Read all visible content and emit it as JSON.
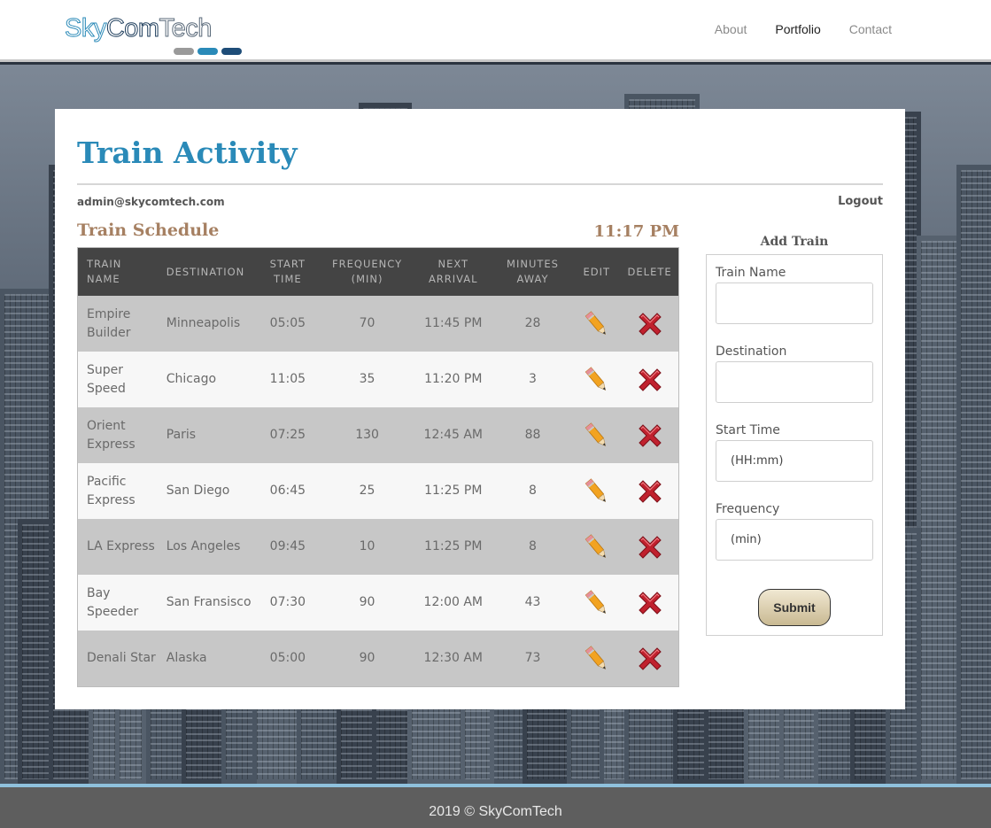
{
  "brand": {
    "name": "SkyComTech",
    "part1": "Sky",
    "part2": "Com",
    "part3": "Tech",
    "pill_colors": [
      "#9a9a9a",
      "#2a8ab8",
      "#1e4d78"
    ]
  },
  "nav": {
    "items": [
      {
        "label": "About"
      },
      {
        "label": "Portfolio"
      },
      {
        "label": "Contact"
      }
    ],
    "active": "Portfolio"
  },
  "page": {
    "title": "Train Activity",
    "user_email": "admin@skycomtech.com",
    "logout_label": "Logout"
  },
  "schedule": {
    "title": "Train Schedule",
    "current_time": "11:17 PM",
    "headers": {
      "train_name": "Train Name",
      "destination": "Destination",
      "start_time": "Start Time",
      "frequency": "Frequency (min)",
      "next_arrival": "Next Arrival",
      "minutes_away": "Minutes Away",
      "edit": "Edit",
      "delete": "Delete"
    },
    "rows": [
      {
        "name": "Empire Builder",
        "destination": "Minneapolis",
        "start": "05:05",
        "frequency": "70",
        "next": "11:45 PM",
        "minutes": "28"
      },
      {
        "name": "Super Speed",
        "destination": "Chicago",
        "start": "11:05",
        "frequency": "35",
        "next": "11:20 PM",
        "minutes": "3"
      },
      {
        "name": "Orient Express",
        "destination": "Paris",
        "start": "07:25",
        "frequency": "130",
        "next": "12:45 AM",
        "minutes": "88"
      },
      {
        "name": "Pacific Express",
        "destination": "San Diego",
        "start": "06:45",
        "frequency": "25",
        "next": "11:25 PM",
        "minutes": "8"
      },
      {
        "name": "LA Express",
        "destination": "Los Angeles",
        "start": "09:45",
        "frequency": "10",
        "next": "11:25 PM",
        "minutes": "8"
      },
      {
        "name": "Bay Speeder",
        "destination": "San Fransisco",
        "start": "07:30",
        "frequency": "90",
        "next": "12:00 AM",
        "minutes": "43"
      },
      {
        "name": "Denali Star",
        "destination": "Alaska",
        "start": "05:00",
        "frequency": "90",
        "next": "12:30 AM",
        "minutes": "73"
      }
    ],
    "edit_icon": "pencil-icon",
    "delete_icon": "red-x-icon"
  },
  "add_train": {
    "title": "Add Train",
    "train_name_label": "Train Name",
    "train_name_value": "",
    "destination_label": "Destination",
    "destination_value": "",
    "start_time_label": "Start Time",
    "start_time_placeholder": "(HH:mm)",
    "frequency_label": "Frequency",
    "frequency_placeholder": "(min)",
    "submit_label": "Submit"
  },
  "footer": {
    "text": "2019 © SkyComTech"
  },
  "colors": {
    "accent": "#2a8ab8",
    "schedule_title": "#a68062",
    "table_header": "#444444",
    "row_alt": "#c7c7c7",
    "footer": "#5e5e5e"
  }
}
